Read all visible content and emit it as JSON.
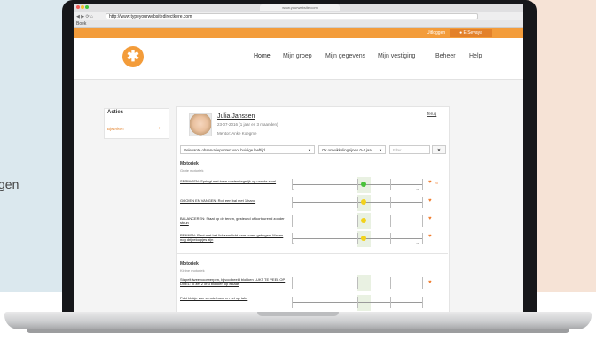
{
  "background_text": "gen",
  "browser": {
    "url": "http://www.typeyourwebsitedirectkere.com",
    "tab_title": "www.yourwebsite.com",
    "bookmarks": "Boek"
  },
  "topbar": {
    "login_label": "Uitloggen",
    "user_label": "E.Sevaya"
  },
  "nav": {
    "items": [
      "Home",
      "Mijn groep",
      "Mijn gegevens",
      "Mijn vestiging",
      "Beheer",
      "Help"
    ]
  },
  "sidebar": {
    "title": "Acties",
    "link": "Bjwerken",
    "arrow": "›"
  },
  "child": {
    "name": "Julia Janssen",
    "dob": "23-07-2016 (1 jaar en 3 maanden)",
    "mentor": "Mentor: Anke Koegme",
    "back": "Terug"
  },
  "filters": {
    "observation_select": "Relevante observatiepunten voor huidige leeftijd",
    "age_select": "Ok ontwikkelingsijnen 0-4 jaar",
    "filter_placeholder": "Filter",
    "clear": "✕"
  },
  "sections": [
    {
      "title": "Motoriek",
      "subtitle": "Grote motoriek",
      "items": [
        {
          "text": "SPRINGEN: Springt met twee voeten tegelijk op van de stoel",
          "marker": "green",
          "value": "20"
        },
        {
          "text": "GOOIEN EN VANGEN: Rolt een bal met 1 hand",
          "marker": "yellow",
          "value": ""
        },
        {
          "text": "BALANCEREN: Staat op de tenen, gesteund of kortdurend zonder steun",
          "marker": "yellow",
          "value": ""
        },
        {
          "text": "RENNEN: Rent met het lichaam licht naar voren gebogen. Maken nog drijbeloopjes zijn",
          "marker": "yellow",
          "value": ""
        }
      ]
    },
    {
      "title": "Motoriek",
      "subtitle": "Kleine motoriek",
      "items": [
        {
          "text": "Stapelt twee voorwerpen, bijvoorbeeld blokken LUKT TE VEEL OP DOEL: Ik zet 2 of 3 blokken op elkaar",
          "marker": "",
          "value": ""
        },
        {
          "text": "Pakt blokje van vensterbank en zet op tafel",
          "marker": "",
          "value": ""
        }
      ]
    }
  ],
  "scale_labels": {
    "start": "0",
    "end": "24"
  },
  "colors": {
    "orange": "#f39c3a",
    "green_marker": "#49c23a",
    "yellow_marker": "#f2d21c",
    "heart": "#f07c2c"
  }
}
